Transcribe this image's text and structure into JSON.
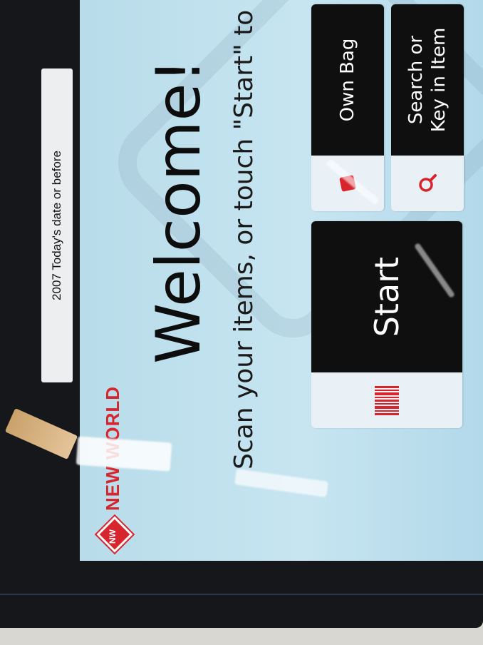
{
  "sticker": {
    "text": "2007 Today's date or before"
  },
  "brand": {
    "badge": "NW",
    "name": "NEW WORLD",
    "color": "#d8242c"
  },
  "welcome": {
    "title": "Welcome!",
    "subtitle": "Scan your items, or touch \"Start\" to begi"
  },
  "buttons": {
    "start": {
      "label": "Start",
      "icon": "barcode-icon"
    },
    "own_bag": {
      "label": "Own Bag",
      "icon": "bag-icon"
    },
    "search": {
      "label_line1": "Search or",
      "label_line2": "Key in Item",
      "icon": "magnifier-icon"
    }
  },
  "colors": {
    "accent": "#d8242c",
    "button_dark": "#0f0f10",
    "screen_bg": "#c7e5f1"
  }
}
